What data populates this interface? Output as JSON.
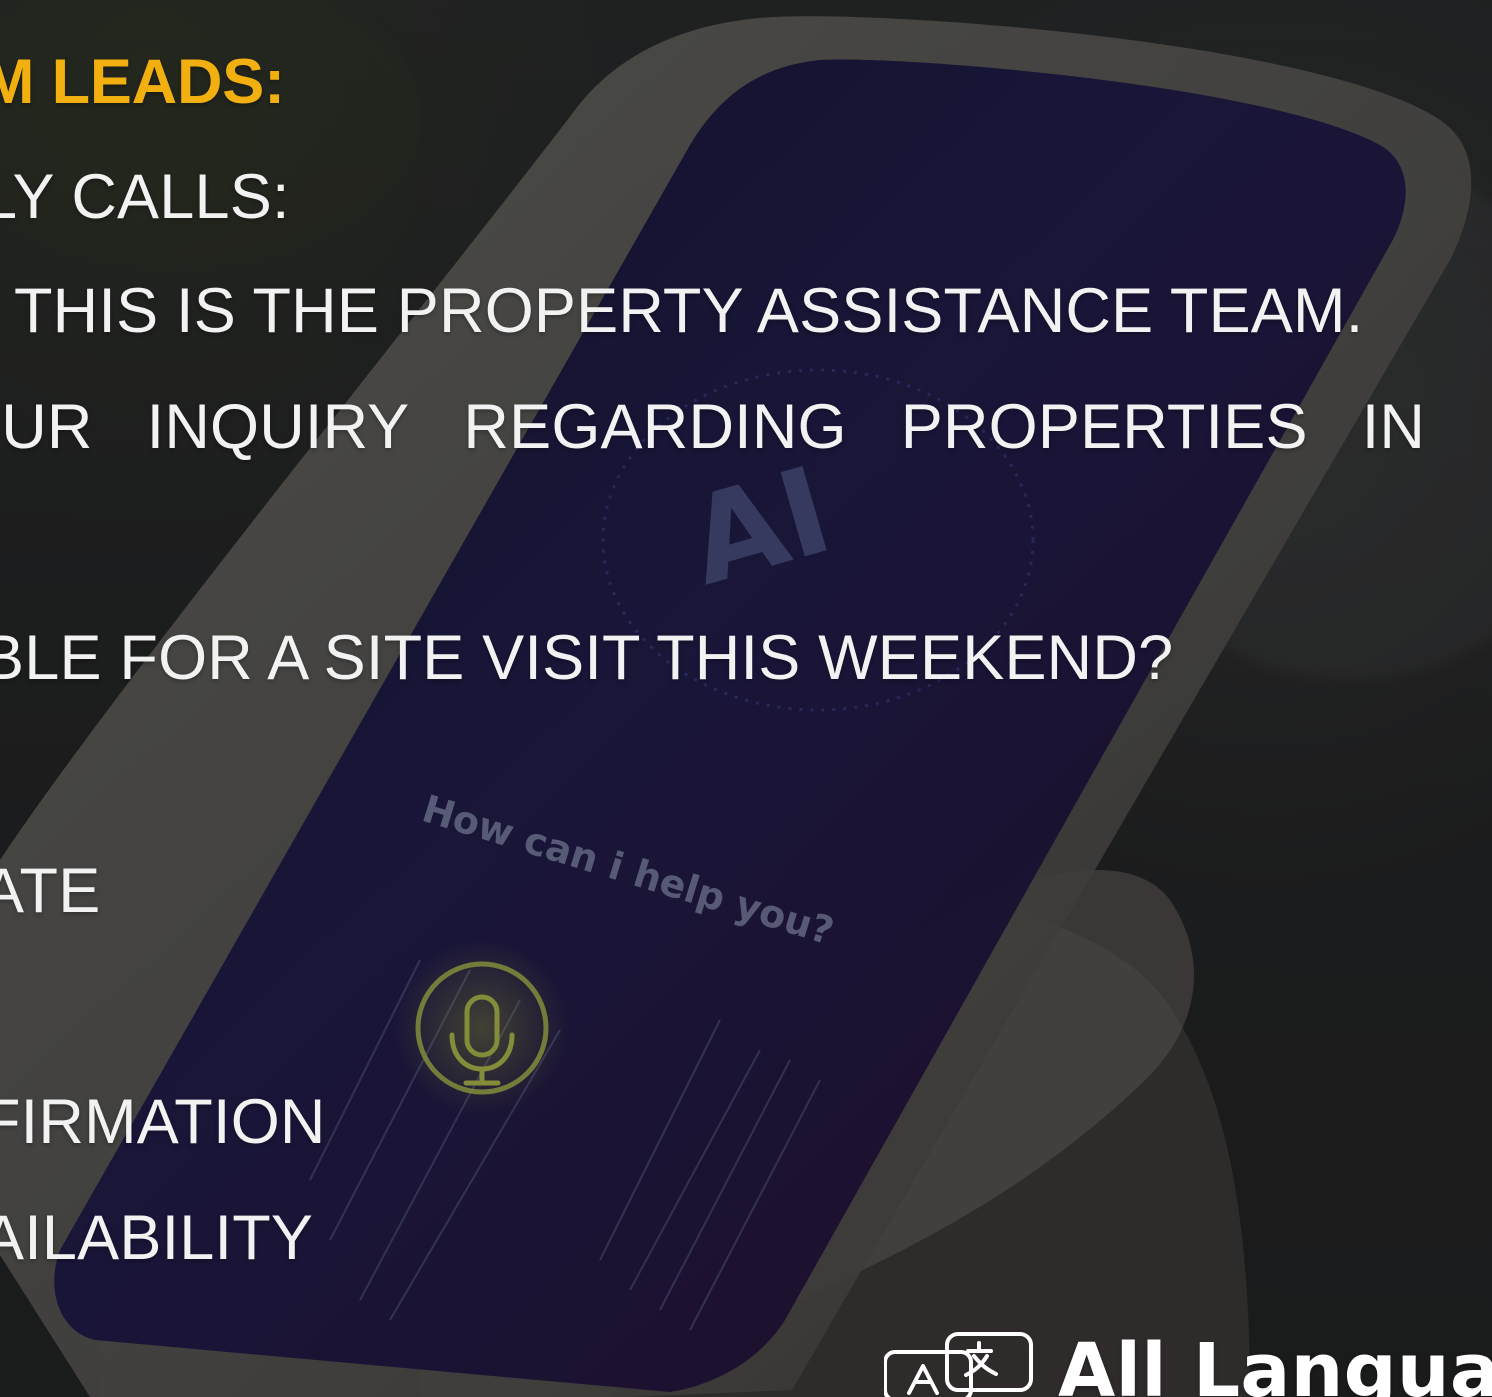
{
  "overlay_text": {
    "heading": "M LEADS:",
    "calls": "LY CALLS:",
    "team": "THIS IS THE PROPERTY ASSISTANCE TEAM.",
    "inquiry": {
      "parts": [
        "OUR",
        "INQUIRY",
        "REGARDING",
        "PROPERTIES",
        "IN"
      ]
    },
    "site_visit": "BLE FOR A SITE VISIT THIS WEEKEND?",
    "ate": "ATE",
    "firmation": "FIRMATION",
    "ailability": "AILABILITY"
  },
  "phone_screen": {
    "ai_label": "AI",
    "prompt": "How can i help you?"
  },
  "brand": {
    "name": "All Languag"
  }
}
